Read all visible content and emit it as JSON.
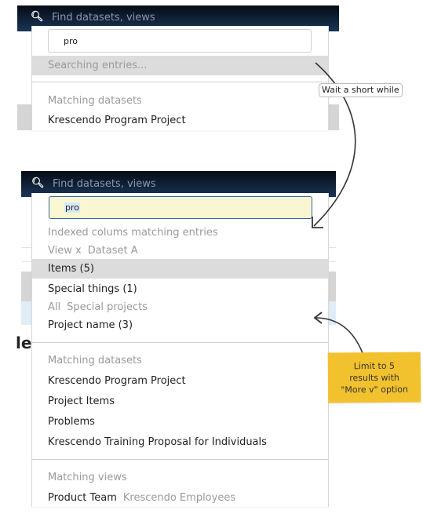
{
  "state_searching": {
    "nav": {
      "search_icon": "magnifier-icon",
      "placeholder": "Find datasets, views"
    },
    "query": "pro",
    "status_row": "Searching entries...",
    "sections": [
      {
        "heading": "Matching datasets",
        "items": [
          "Krescendo Program Project"
        ]
      }
    ]
  },
  "state_results": {
    "nav": {
      "search_icon": "magnifier-icon",
      "placeholder": "Find datasets, views"
    },
    "query": "pro",
    "indexed": {
      "heading": "Indexed colums matching entries",
      "groups": [
        {
          "breadcrumb": [
            "View x",
            "Dataset A"
          ],
          "items": [
            {
              "label": "Items (5)",
              "highlighted": true
            }
          ]
        },
        {
          "breadcrumb": null,
          "items": [
            {
              "label": "Special things (1)",
              "highlighted": false
            }
          ]
        },
        {
          "breadcrumb": [
            "All",
            "Special projects"
          ],
          "items": [
            {
              "label": "Project name (3)",
              "highlighted": false
            }
          ]
        }
      ]
    },
    "datasets": {
      "heading": "Matching datasets",
      "items": [
        "Krescendo Program Project",
        "Project Items",
        "Problems",
        "Krescendo Training Proposal for Individuals"
      ]
    },
    "views": {
      "heading": "Matching views",
      "items": [
        {
          "label": "Product Team",
          "context": "Krescendo Employees"
        }
      ]
    },
    "background_heading_fragment": "le"
  },
  "annotations": {
    "wait_note": "Wait a short while",
    "limit_note": [
      "Limit to 5",
      "results with",
      "\"More v\" option"
    ],
    "note_color": "#f2c12e"
  }
}
